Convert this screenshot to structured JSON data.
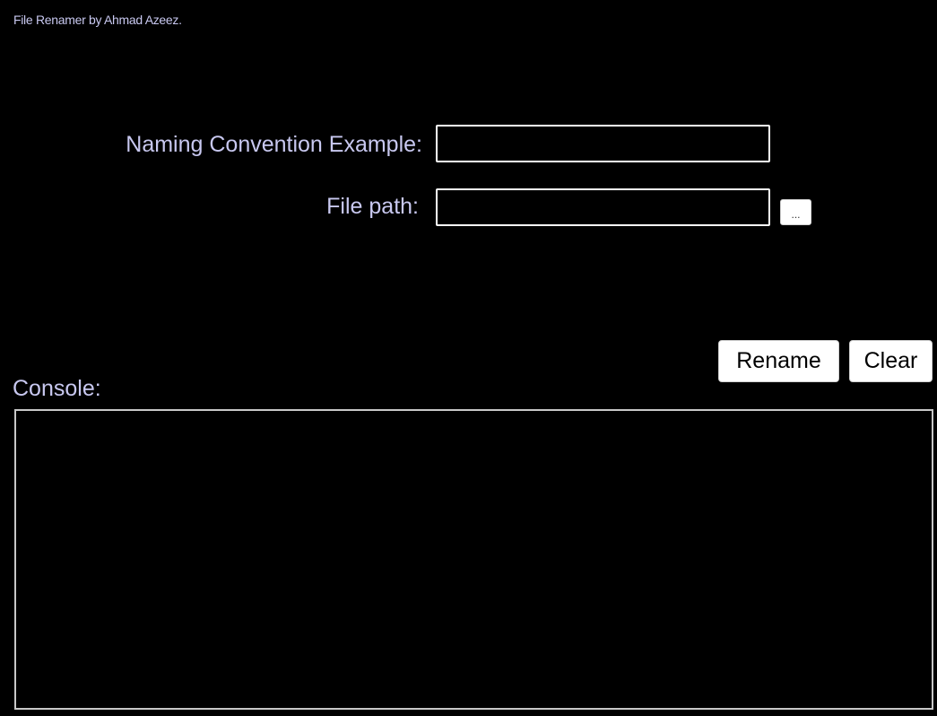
{
  "app": {
    "title": "File Renamer by Ahmad Azeez."
  },
  "form": {
    "naming_label": "Naming Convention Example:",
    "naming_value": "",
    "path_label": "File path:",
    "path_value": "",
    "browse_label": "..."
  },
  "actions": {
    "rename_label": "Rename",
    "clear_label": "Clear"
  },
  "console": {
    "label": "Console:",
    "content": ""
  },
  "colors": {
    "background": "#000000",
    "label_text": "#c8c8f0",
    "field_border": "#ffffff",
    "button_bg": "#ffffff"
  }
}
